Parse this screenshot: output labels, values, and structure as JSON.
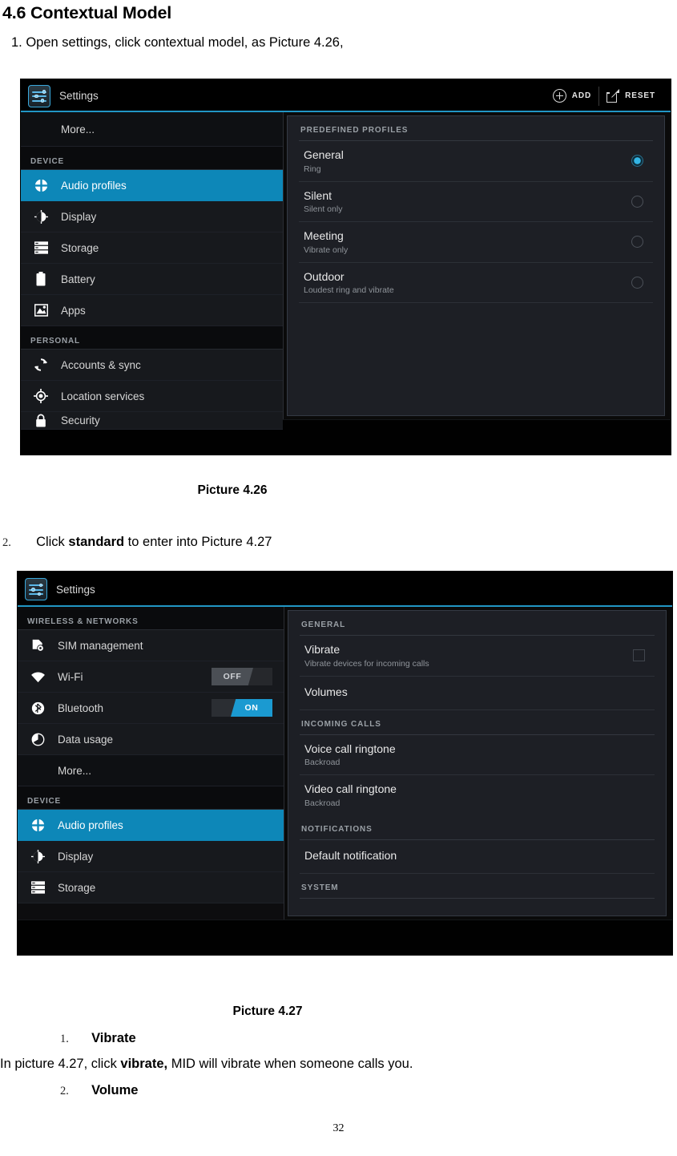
{
  "document": {
    "section_heading": "4.6 Contextual Model",
    "step1": "1. Open settings, click contextual model, as Picture 4.26,",
    "caption1": "Picture 4.26",
    "step2_num": "2.",
    "step2_pre": "Click ",
    "step2_bold": "standard",
    "step2_post": " to enter into Picture 4.27",
    "caption2": "Picture 4.27",
    "sub1_num": "1.",
    "sub1_label": "Vibrate",
    "sub1_body_pre": "In picture 4.27, click ",
    "sub1_body_bold": "vibrate,",
    "sub1_body_post": " MID will vibrate when someone calls you.",
    "sub2_num": "2.",
    "sub2_label": "Volume",
    "page_number": "32"
  },
  "colors": {
    "accent_blue": "#0d87b8",
    "actionbar_rule": "#2196c4",
    "radio_on": "#33b5e5",
    "toggle_on": "#1b9ad1",
    "panel_bg": "#1d1f25",
    "list_bg": "#17191d"
  },
  "picture426": {
    "app_title": "Settings",
    "app_icon": "settings-sliders-icon",
    "actions": [
      {
        "icon": "plus-circle-icon",
        "label": "ADD"
      },
      {
        "icon": "share-export-icon",
        "label": "RESET"
      }
    ],
    "left_list": [
      {
        "type": "item",
        "icon": "",
        "label": "More...",
        "selected": false,
        "noicon": true
      },
      {
        "type": "header",
        "label": "DEVICE"
      },
      {
        "type": "item",
        "icon": "audio-profiles-icon",
        "label": "Audio profiles",
        "selected": true
      },
      {
        "type": "item",
        "icon": "display-brightness-icon",
        "label": "Display",
        "selected": false
      },
      {
        "type": "item",
        "icon": "storage-icon",
        "label": "Storage",
        "selected": false
      },
      {
        "type": "item",
        "icon": "battery-icon",
        "label": "Battery",
        "selected": false
      },
      {
        "type": "item",
        "icon": "apps-image-icon",
        "label": "Apps",
        "selected": false
      },
      {
        "type": "header",
        "label": "PERSONAL"
      },
      {
        "type": "item",
        "icon": "accounts-sync-icon",
        "label": "Accounts & sync",
        "selected": false
      },
      {
        "type": "item",
        "icon": "location-services-icon",
        "label": "Location services",
        "selected": false
      },
      {
        "type": "item",
        "icon": "security-lock-icon",
        "label": "Security",
        "selected": false
      }
    ],
    "right_header": "PREDEFINED PROFILES",
    "profiles": [
      {
        "title": "General",
        "sub": "Ring",
        "selected": true
      },
      {
        "title": "Silent",
        "sub": "Silent only",
        "selected": false
      },
      {
        "title": "Meeting",
        "sub": "Vibrate only",
        "selected": false
      },
      {
        "title": "Outdoor",
        "sub": "Loudest ring and vibrate",
        "selected": false
      }
    ]
  },
  "picture427": {
    "app_title": "Settings",
    "app_icon": "settings-sliders-icon",
    "left_list": [
      {
        "type": "header",
        "label": "WIRELESS & NETWORKS"
      },
      {
        "type": "item",
        "icon": "sim-card-icon",
        "label": "SIM management",
        "toggle": null
      },
      {
        "type": "item",
        "icon": "wifi-icon",
        "label": "Wi-Fi",
        "toggle": "OFF"
      },
      {
        "type": "item",
        "icon": "bluetooth-icon",
        "label": "Bluetooth",
        "toggle": "ON"
      },
      {
        "type": "item",
        "icon": "data-usage-icon",
        "label": "Data usage",
        "toggle": null
      },
      {
        "type": "item",
        "icon": "",
        "label": "More...",
        "noicon": true,
        "toggle": null
      },
      {
        "type": "header",
        "label": "DEVICE"
      },
      {
        "type": "item",
        "icon": "audio-profiles-icon",
        "label": "Audio profiles",
        "selected": true,
        "toggle": null
      },
      {
        "type": "item",
        "icon": "display-brightness-icon",
        "label": "Display",
        "toggle": null
      },
      {
        "type": "item",
        "icon": "storage-icon",
        "label": "Storage",
        "toggle": null
      }
    ],
    "right_groups": [
      {
        "header": "GENERAL",
        "rows": [
          {
            "title": "Vibrate",
            "sub": "Vibrate devices for incoming calls",
            "control": "checkbox"
          },
          {
            "title": "Volumes",
            "sub": "",
            "control": "none"
          }
        ]
      },
      {
        "header": "INCOMING CALLS",
        "rows": [
          {
            "title": "Voice call ringtone",
            "sub": "Backroad",
            "control": "none"
          },
          {
            "title": "Video call ringtone",
            "sub": "Backroad",
            "control": "none"
          }
        ]
      },
      {
        "header": "NOTIFICATIONS",
        "rows": [
          {
            "title": "Default notification",
            "sub": "",
            "control": "none"
          }
        ]
      },
      {
        "header": "SYSTEM",
        "rows": []
      }
    ]
  }
}
